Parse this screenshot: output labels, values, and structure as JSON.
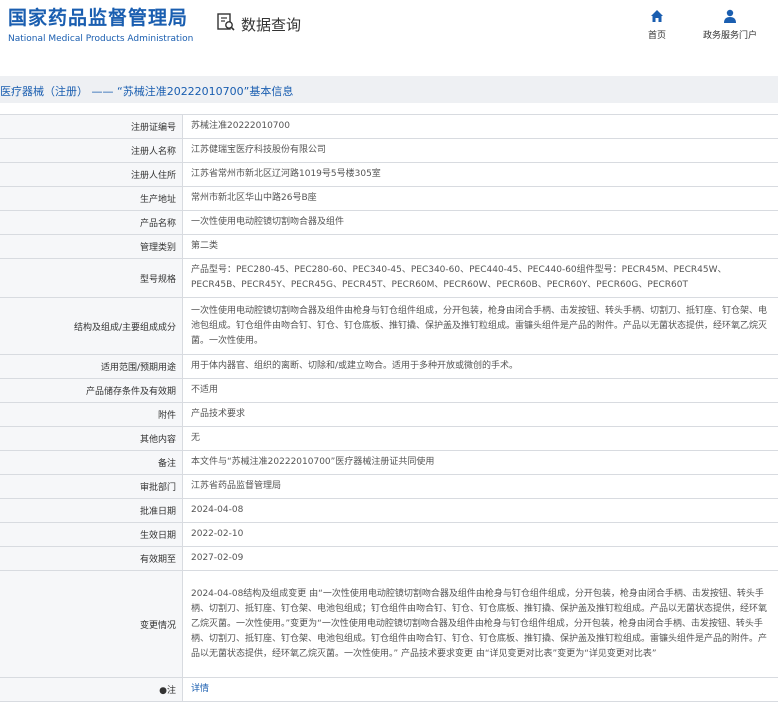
{
  "header": {
    "logo_cn": "国家药品监督管理局",
    "logo_en": "National Medical Products Administration",
    "query_label": "数据查询",
    "nav": [
      {
        "label": "首页",
        "icon": "home-icon"
      },
      {
        "label": "政务服务门户",
        "icon": "user-icon"
      }
    ]
  },
  "breadcrumb": "医疗器械（注册） —— “苏械注准20222010700”基本信息",
  "colors": {
    "brand": "#1a5eb0",
    "label_bg": "#f6f7f9",
    "border": "#d8dbe0"
  },
  "rows": [
    {
      "label": "注册证编号",
      "value": "苏械注准20222010700"
    },
    {
      "label": "注册人名称",
      "value": "江苏健瑞宝医疗科技股份有限公司"
    },
    {
      "label": "注册人住所",
      "value": "江苏省常州市新北区辽河路1019号5号楼305室"
    },
    {
      "label": "生产地址",
      "value": "常州市新北区华山中路26号B座"
    },
    {
      "label": "产品名称",
      "value": "一次性使用电动腔镜切割吻合器及组件"
    },
    {
      "label": "管理类别",
      "value": "第二类"
    },
    {
      "label": "型号规格",
      "value": "产品型号：PEC280-45、PEC280-60、PEC340-45、PEC340-60、PEC440-45、PEC440-60组件型号：PECR45M、PECR45W、PECR45B、PECR45Y、PECR45G、PECR45T、PECR60M、PECR60W、PECR60B、PECR60Y、PECR60G、PECR60T"
    },
    {
      "label": "结构及组成/主要组成成分",
      "value": "一次性使用电动腔镜切割吻合器及组件由枪身与钉仓组件组成，分开包装，枪身由闭合手柄、击发按钮、转头手柄、切割刀、抵钉座、钉仓架、电池包组成。钉仓组件由吻合钉、钉仓、钉仓底板、推钉撬、保护盖及推钉粒组成。雷镰头组件是产品的附件。产品以无菌状态提供，经环氧乙烷灭菌。一次性使用。"
    },
    {
      "label": "适用范围/预期用途",
      "value": "用于体内器官、组织的离断、切除和/或建立吻合。适用于多种开放或微创的手术。"
    },
    {
      "label": "产品储存条件及有效期",
      "value": "不适用"
    },
    {
      "label": "附件",
      "value": "产品技术要求"
    },
    {
      "label": "其他内容",
      "value": "无"
    },
    {
      "label": "备注",
      "value": "本文件与“苏械注准20222010700”医疗器械注册证共同使用"
    },
    {
      "label": "审批部门",
      "value": "江苏省药品监督管理局"
    },
    {
      "label": "批准日期",
      "value": "2024-04-08"
    },
    {
      "label": "生效日期",
      "value": "2022-02-10"
    },
    {
      "label": "有效期至",
      "value": "2027-02-09"
    },
    {
      "label": "变更情况",
      "value": "2024-04-08结构及组成变更 由“一次性使用电动腔镜切割吻合器及组件由枪身与钉仓组件组成，分开包装，枪身由闭合手柄、击发按钮、转头手柄、切割刀、抵钉座、钉仓架、电池包组成；钉仓组件由吻合钉、钉仓、钉仓底板、推钉撬、保护盖及推钉粒组成。产品以无菌状态提供，经环氧乙烷灭菌。一次性使用。”变更为“一次性使用电动腔镜切割吻合器及组件由枪身与钉仓组件组成，分开包装，枪身由闭合手柄、击发按钮、转头手柄、切割刀、抵钉座、钉仓架、电池包组成。钉仓组件由吻合钉、钉仓、钉仓底板、推钉撬、保护盖及推钉粒组成。雷镰头组件是产品的附件。产品以无菌状态提供，经环氧乙烷灭菌。一次性使用。” 产品技术要求变更 由“详见变更对比表”变更为“详见变更对比表”"
    },
    {
      "label": "●注",
      "value": "详情",
      "link": true
    }
  ]
}
